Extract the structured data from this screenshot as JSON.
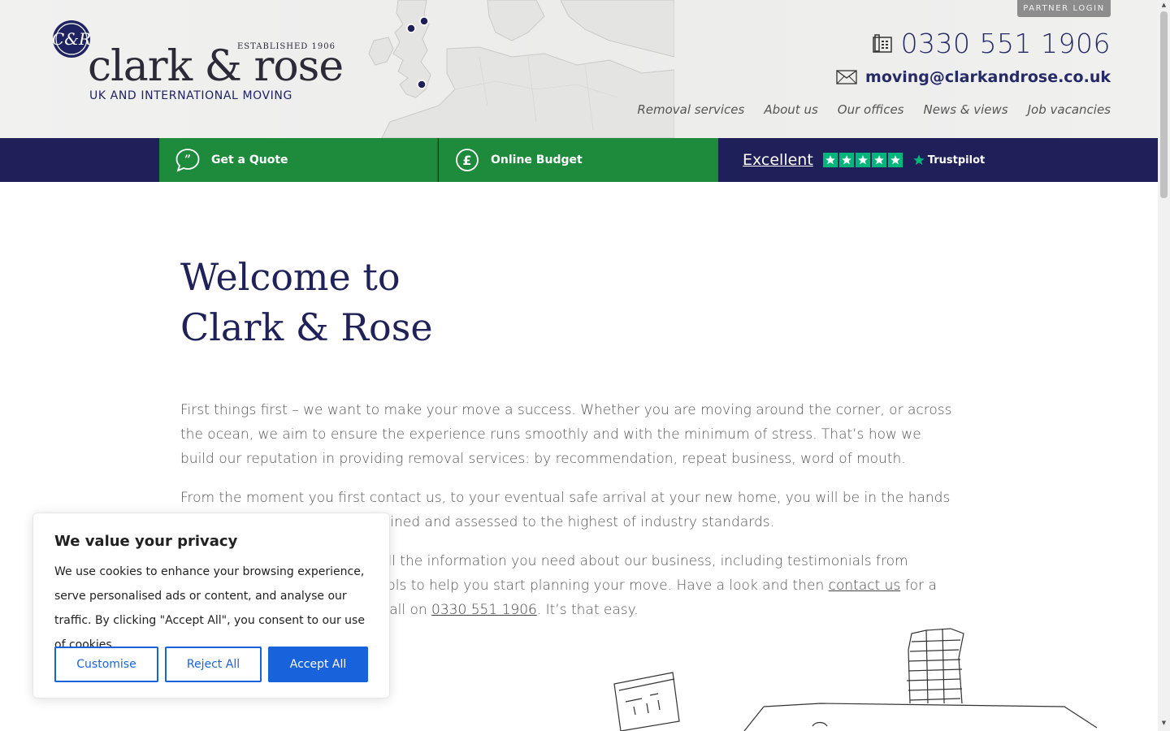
{
  "header": {
    "partner_login": "PARTNER LOGIN",
    "brand_name": "clark & rose",
    "established": "ESTABLISHED 1906",
    "tagline": "UK AND INTERNATIONAL MOVING",
    "phone": "0330 551 1906",
    "email": "moving@clarkandrose.co.uk",
    "nav": [
      "Removal services",
      "About us",
      "Our offices",
      "News & views",
      "Job vacancies"
    ]
  },
  "actionbar": {
    "quote_label": "Get a Quote",
    "budget_label": "Online Budget",
    "trust_rating": "Excellent",
    "trust_brand": "Trustpilot"
  },
  "content": {
    "title_line1": "Welcome to",
    "title_line2": "Clark & Rose",
    "p1": "First things first – we want to make your move a success.  Whether you are moving around the corner, or across the ocean, we aim to ensure the experience runs smoothly and with the minimum of stress. That’s how we build our reputation in providing removal services: by recommendation, repeat business, word of mouth.",
    "p2": "From the moment you first contact us, to your eventual safe arrival at your new home, you will be in the hands of dedicated professionals, trained and assessed to the highest of industry standards.",
    "p3_a": "On this website you will find all the information you need about our business, including testimonials from customers, free guides and tools to help you start planning your move. Have a look and then ",
    "p3_link": "contact us",
    "p3_b": " for a free survey, or just give us a call on ",
    "p3_phone": "0330 551 1906",
    "p3_c": ". It’s that easy."
  },
  "cookie": {
    "title": "We value your privacy",
    "text": "We use cookies to enhance your browsing experience, serve personalised ads or content, and analyse our traffic. By clicking \"Accept All\", you consent to our use of cookies.",
    "customise": "Customise",
    "reject": "Reject All",
    "accept": "Accept All"
  },
  "colors": {
    "navy": "#1f1f5a",
    "green": "#1e8a3c",
    "trustpilot": "#00b67a",
    "cookie_blue": "#1863dc"
  }
}
